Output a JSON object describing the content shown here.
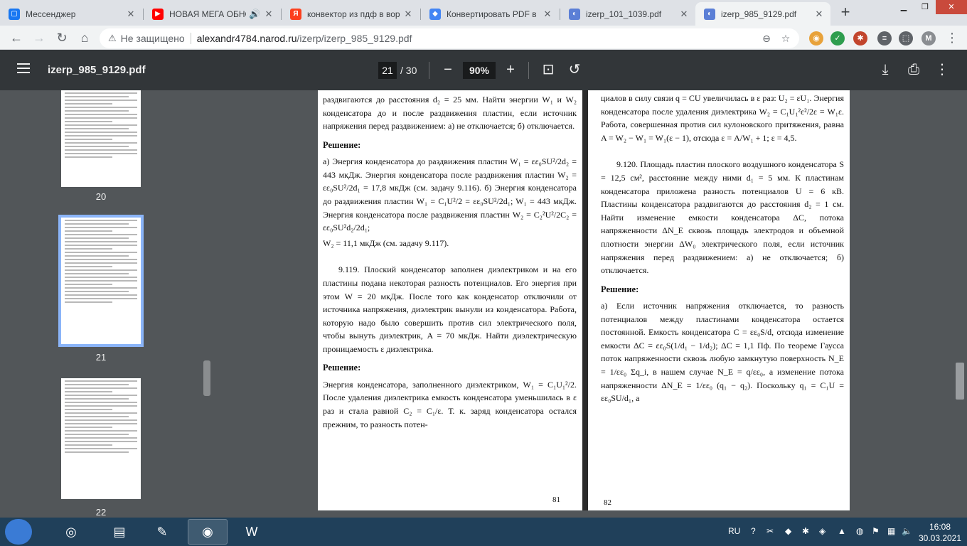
{
  "browser": {
    "tabs": [
      {
        "title": "Мессенджер",
        "icon": "messenger-icon",
        "color": "#1877f2",
        "glyph": "▢"
      },
      {
        "title": "НОВАЯ МЕГА ОБНО",
        "icon": "youtube-icon",
        "color": "#ff0000",
        "glyph": "▶"
      },
      {
        "title": "конвектор из пдф в вор",
        "icon": "yandex-icon",
        "color": "#fc3f1d",
        "glyph": "Я"
      },
      {
        "title": "Конвертировать PDF в",
        "icon": "google-icon",
        "color": "#4285f4",
        "glyph": "◆"
      },
      {
        "title": "izerp_101_1039.pdf",
        "icon": "pdf-icon",
        "color": "#5b7fd6",
        "glyph": "◐"
      },
      {
        "title": "izerp_985_9129.pdf",
        "icon": "pdf-icon",
        "color": "#5b7fd6",
        "glyph": "◐"
      }
    ],
    "new_tab_label": "+",
    "address": {
      "security_label": "Не защищено",
      "url_host": "alexandr4784.narod.ru",
      "url_path": "/izerp/izerp_985_9129.pdf"
    },
    "profile_initial": "M"
  },
  "pdf_toolbar": {
    "title": "izerp_985_9129.pdf",
    "current_page": "21",
    "total_pages": "/ 30",
    "zoom": "90%"
  },
  "thumbnails": [
    {
      "label": "20"
    },
    {
      "label": "21"
    },
    {
      "label": "22"
    }
  ],
  "page": {
    "left": {
      "intro_1": "раздвигаются до расстояния d₂ = 25 мм. Найти энергии W₁ и W₂ конденсатора до и после раздвижения пластин, если источник напряжения перед раздвижением: а) не отключается; б) отключается.",
      "solution_head_1": "Решение:",
      "sol_a_1": "а) Энергия конденсатора до раздвижения пластин W₁ = εε₀SU²/2d₂ = 443 мкДж. Энергия конденсатора после раздвижения пластин W₂ = εε₀SU²/2d₁ = 17,8 мкДж (см. задачу 9.116). б) Энергия конденсатора до раздвижения пластин W₁ = C₁U²/2 = εε₀SU²/2d₁; W₁ = 443 мкДж. Энергия конденсатора после раздвижения пластин W₂ = C₂²U²/2C₂ = εε₀SU²d₂/2d₁;",
      "sol_a_2": "W₂ = 11,1 мкДж (см. задачу 9.117).",
      "problem_119": "9.119. Плоский конденсатор заполнен диэлектриком и на его пластины подана некоторая разность потенциалов. Его энергия при этом W = 20 мкДж. После того как конденсатор отключили от источника напряжения, диэлектрик вынули из конденсатора. Работа, которую надо было совершить против сил электрического поля, чтобы вынуть диэлектрик, A = 70 мкДж. Найти диэлектрическую проницаемость ε диэлектрика.",
      "solution_head_2": "Решение:",
      "sol_119": "Энергия конденсатора, заполненного диэлектриком, W₁ = C₁U₁²/2. После удаления диэлектрика емкость конденсатора уменьшилась в ε раз и стала равной C₂ = C₁/ε. Т. к. заряд конденсатора остался прежним, то разность потен-",
      "page_number": "81"
    },
    "right": {
      "cont": "циалов в силу связи q = CU увеличилась в ε раз: U₂ = εU₁. Энергия конденсатора после удаления диэлектрика W₂ = C₁U₁²ε²/2ε = W₁ε. Работа, совершенная против сил кулоновского притяжения, равна A = W₂ − W₁ = W₁(ε − 1), отсюда ε = A/W₁ + 1; ε = 4,5.",
      "problem_120": "9.120. Площадь пластин плоского воздушного конденсатора S = 12,5 см², расстояние между ними d₁ = 5 мм. К пластинам конденсатора приложена разность потенциалов U = 6 кВ. Пластины конденсатора раздвигаются до расстояния d₂ = 1 см. Найти изменение емкости конденсатора ΔC, потока напряженности ΔN_E сквозь площадь электродов и объемной плотности энергии ΔW₀ электрического поля, если источник напряжения перед раздвижением: а) не отключается; б) отключается.",
      "solution_head": "Решение:",
      "sol_120": "а) Если источник напряжения отключается, то разность потенциалов между пластинами конденсатора остается постоянной. Емкость конденсатора C = εε₀S/d, отсюда изменение емкости ΔC = εε₀S(1/d₁ − 1/d₂); ΔC = 1,1 Пф. По теореме Гаусса поток напряженности сквозь любую замкнутую поверхность N_E = 1/εε₀ Σq_i, в нашем случае N_E = q/εε₀, а изменение потока напряженности ΔN_E = 1/εε₀ (q₁ − q₂). Поскольку q₁ = C₁U = εε₀SU/d₁, а",
      "page_number": "82"
    }
  },
  "taskbar": {
    "language": "RU",
    "time": "16:08",
    "date": "30.03.2021"
  }
}
